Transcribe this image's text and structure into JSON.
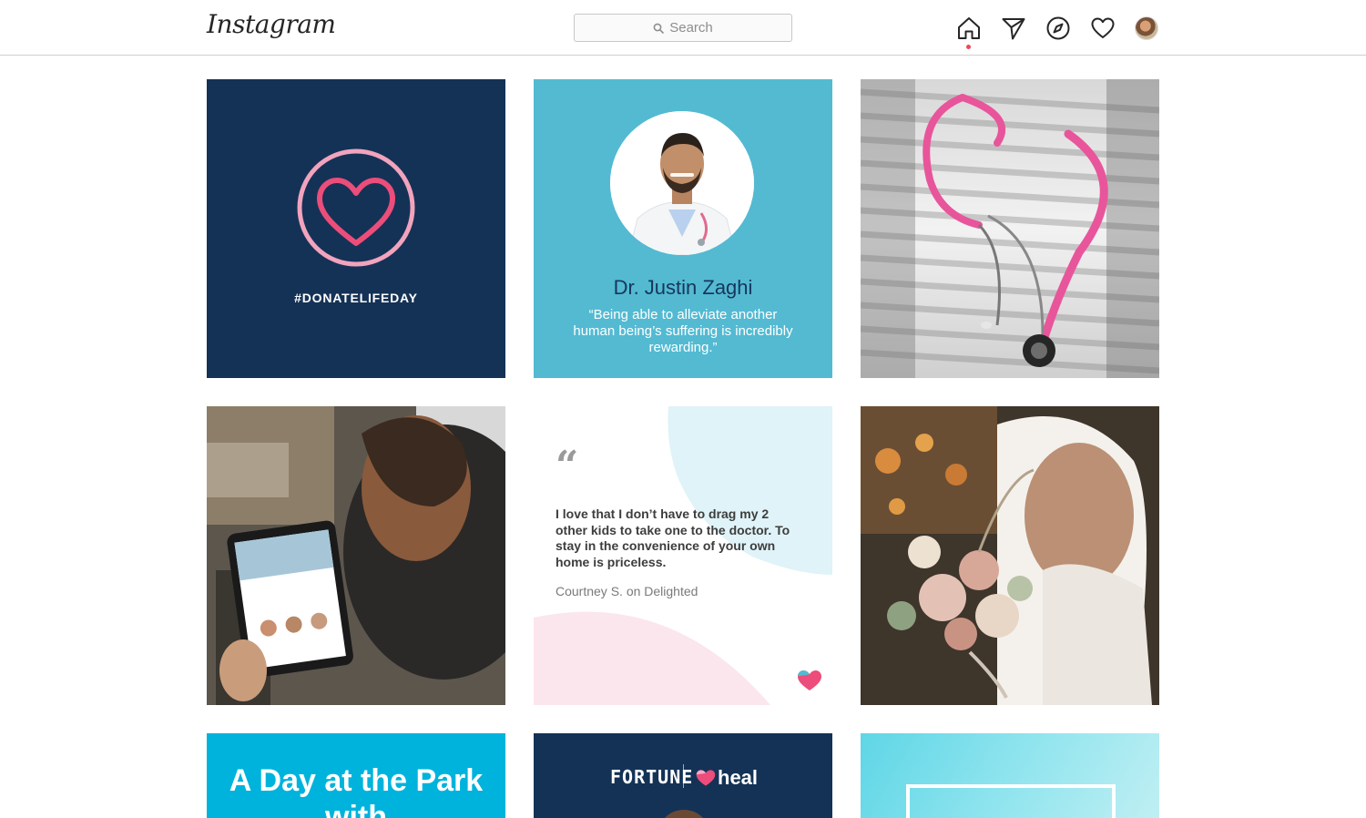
{
  "app": {
    "logo_text": "Instagram"
  },
  "search": {
    "placeholder": "Search"
  },
  "nav": {
    "icons": [
      "home-icon",
      "direct-message-icon",
      "explore-compass-icon",
      "activity-heart-icon",
      "profile-avatar"
    ]
  },
  "posts": {
    "p1": {
      "hashtag": "#DONATELIFEDAY"
    },
    "p2": {
      "name": "Dr. Justin Zaghi",
      "quote": "“Being able to alleviate another human being’s suffering is incredibly rewarding.”"
    },
    "p5": {
      "quote_mark": "“",
      "quote": "I love that I don’t have to drag my 2 other kids to take one to the doctor. To stay in the convenience of your own home is priceless.",
      "author": "Courtney S. on Delighted"
    },
    "p7": {
      "title": "A Day at the Park with"
    },
    "p8": {
      "brand1": "FORTUNE",
      "brand2": "heal"
    }
  },
  "colors": {
    "brand_navy": "#143256",
    "brand_teal": "#53bad2",
    "brand_pink": "#ec4d7a",
    "active_dot": "#ed4956"
  }
}
